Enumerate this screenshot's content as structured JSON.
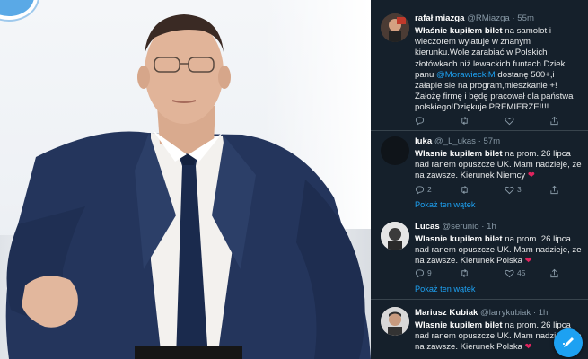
{
  "tweets": [
    {
      "name": "rafał miazga",
      "handle": "@RMiazga",
      "time": "55m",
      "bold": "Właśnie kupiłem bilet",
      "text_before_mention": " na samolot i wieczorem wylatuje w znanym kierunku.Wole zarabiać w Polskich złotówkach niż lewackich funtach.Dzieki panu ",
      "mention": "@MorawieckiM",
      "text_after_mention": " dostanę 500+,i załapie sie na program,mieszkanie +! Założę firmę i będę pracował dla państwa polskiego!Dziękuje PREMIERZE!!!!",
      "retweets": "",
      "likes": ""
    },
    {
      "name": "luka",
      "handle": "@_L_ukas",
      "time": "57m",
      "bold": "Wlasnie kupilem bilet",
      "text": " na prom. 26 lipca nad ranem opuszcze UK. Mam nadzieje, ze na zawsze. Kierunek Niemcy",
      "replies": "2",
      "retweets": "",
      "likes": "3",
      "show_thread": "Pokaż ten wątek"
    },
    {
      "name": "Lucas",
      "handle": "@serunio",
      "time": "1h",
      "bold": "Wlasnie kupilem bilet",
      "text": " na prom. 26 lipca nad ranem opuszcze UK. Mam nadzieje, ze na zawsze. Kierunek Polska",
      "replies": "9",
      "retweets": "",
      "likes": "45",
      "show_thread": "Pokaż ten wątek"
    },
    {
      "name": "Mariusz Kubiak",
      "handle": "@larrykubiak",
      "time": "1h",
      "bold": "Wlasnie kupilem bilet",
      "text": " na prom. 26 lipca nad ranem opuszcze UK. Mam nadzieje, ze na zawsze. Kierunek Polska"
    }
  ],
  "colors": {
    "background": "#15202b",
    "accent": "#1da1f2",
    "heart": "#e0245e",
    "muted": "#8899a6"
  },
  "icons": {
    "reply": "reply-icon",
    "retweet": "retweet-icon",
    "like": "heart-icon",
    "share": "share-icon",
    "compose": "compose-icon"
  }
}
